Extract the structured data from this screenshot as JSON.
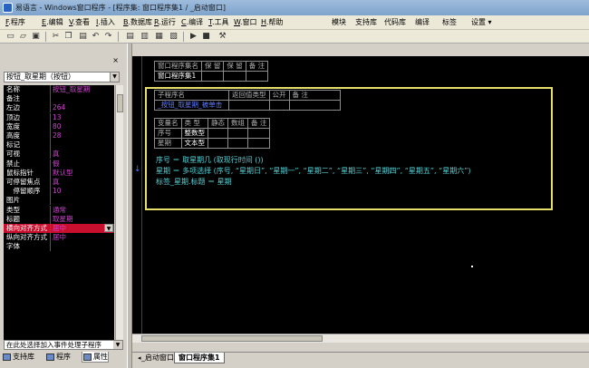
{
  "window": {
    "title": "易语言 - Windows窗口程序 - [程序集: 窗口程序集1 / _启动窗口]"
  },
  "menu": [
    {
      "key": "F",
      "label": "程序"
    },
    {
      "key": "E",
      "label": "编辑"
    },
    {
      "key": "V",
      "label": "查看"
    },
    {
      "key": "I",
      "label": "插入"
    },
    {
      "key": "B",
      "label": "数据库"
    },
    {
      "key": "R",
      "label": "运行"
    },
    {
      "key": "C",
      "label": "编译"
    },
    {
      "key": "T",
      "label": "工具"
    },
    {
      "key": "W",
      "label": "窗口"
    },
    {
      "key": "H",
      "label": "帮助"
    },
    {
      "key": "",
      "label": "模块"
    },
    {
      "key": "",
      "label": "支持库"
    },
    {
      "key": "",
      "label": "代码库"
    },
    {
      "key": "",
      "label": "编译"
    },
    {
      "key": "",
      "label": "标签"
    },
    {
      "key": "",
      "label": "设置 ▾"
    }
  ],
  "toolbar": {
    "icons": [
      "new-file-icon",
      "open-folder-icon",
      "save-icon",
      "cut-icon",
      "copy-icon",
      "paste-icon",
      "undo-icon",
      "redo-icon",
      "view-icon-1",
      "view-icon-2",
      "view-icon-3",
      "view-icon-4",
      "run-icon",
      "stop-icon",
      "compile-icon"
    ]
  },
  "property_panel": {
    "close_glyph": "×",
    "object_select": "按钮_取星期（按钮）",
    "properties": [
      {
        "name": "名称",
        "value": "按钮_取星期"
      },
      {
        "name": "备注",
        "value": ""
      },
      {
        "name": "左边",
        "value": "264"
      },
      {
        "name": "顶边",
        "value": "13"
      },
      {
        "name": "宽度",
        "value": "80"
      },
      {
        "name": "高度",
        "value": "28"
      },
      {
        "name": "标记",
        "value": ""
      },
      {
        "name": "可视",
        "value": "真"
      },
      {
        "name": "禁止",
        "value": "假"
      },
      {
        "name": "鼠标指针",
        "value": "默认型"
      },
      {
        "name": "可停留焦点",
        "value": "真"
      },
      {
        "name": "　停留顺序",
        "value": "10"
      },
      {
        "name": "图片",
        "value": ""
      },
      {
        "name": "类型",
        "value": "通常"
      },
      {
        "name": "标题",
        "value": "取星期"
      },
      {
        "name": "横向对齐方式",
        "value": "居中",
        "selected": true
      },
      {
        "name": "纵向对齐方式",
        "value": "居中"
      },
      {
        "name": "字体",
        "value": ""
      }
    ],
    "event_select": "在此处选择加入事件处理子程序",
    "tabs": [
      {
        "label": "支持库"
      },
      {
        "label": "程序"
      },
      {
        "label": "属性"
      }
    ]
  },
  "code": {
    "assembly_table": {
      "headers": [
        "窗口程序集名",
        "保 留",
        "保 留",
        "备 注"
      ],
      "row": [
        "窗口程序集1",
        "",
        "",
        ""
      ]
    },
    "sub_table": {
      "headers": [
        "子程序名",
        "返回值类型",
        "公开",
        "备 注"
      ],
      "row": [
        "_按钮_取星期_被单击",
        "",
        "",
        ""
      ]
    },
    "var_table": {
      "headers": [
        "变量名",
        "类 型",
        "静态",
        "数组",
        "备 注"
      ],
      "rows": [
        [
          "序号",
          "整数型",
          "",
          "",
          ""
        ],
        [
          "星期",
          "文本型",
          "",
          "",
          ""
        ]
      ]
    },
    "lines": [
      "序号 ＝ 取星期几 (取现行时间 ())",
      "星期 ＝ 多项选择 (序号, “星期日”, “星期一”, “星期二”, “星期三”, “星期四”, “星期五”, “星期六”)",
      "标签_星期.标题 ＝ 星期"
    ],
    "gutter_marker": "↓"
  },
  "bottom_tabs": [
    {
      "label": "_启动窗口"
    },
    {
      "label": "窗口程序集1",
      "active": true
    }
  ]
}
